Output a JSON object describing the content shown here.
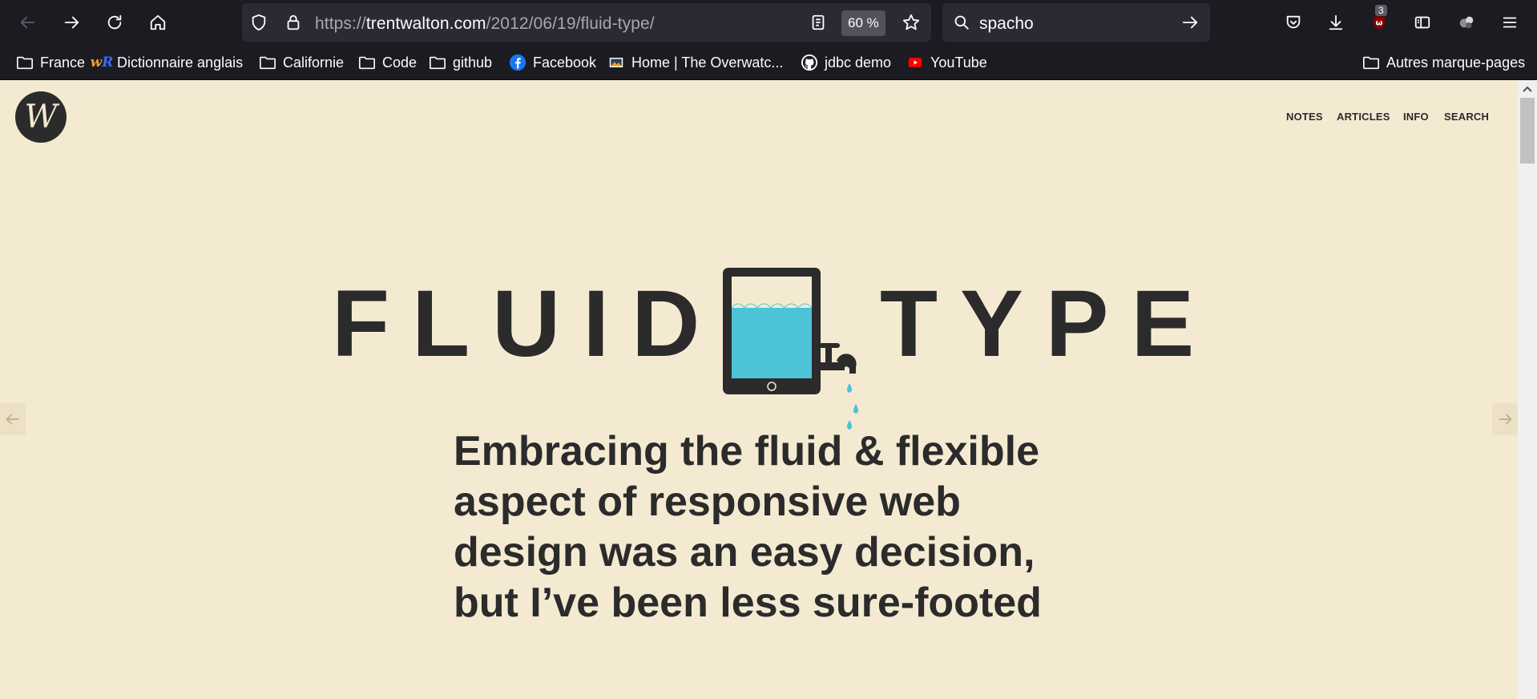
{
  "browser": {
    "url_prefix": "https://",
    "url_domain": "trentwalton.com",
    "url_path": "/2012/06/19/fluid-type/",
    "zoom": "60 %",
    "search_value": "spacho",
    "extension_badge": "3"
  },
  "bookmarks": [
    {
      "label": "France",
      "icon": "folder-icon"
    },
    {
      "label": "Dictionnaire anglais",
      "icon": "wordreference-icon"
    },
    {
      "label": "Californie",
      "icon": "folder-icon"
    },
    {
      "label": "Code",
      "icon": "folder-icon"
    },
    {
      "label": "github",
      "icon": "folder-icon"
    },
    {
      "label": "Facebook",
      "icon": "facebook-icon"
    },
    {
      "label": "Home | The Overwatc...",
      "icon": "overwatch-icon"
    },
    {
      "label": "jdbc demo",
      "icon": "github-icon"
    },
    {
      "label": "YouTube",
      "icon": "youtube-icon"
    }
  ],
  "other_bookmarks": "Autres marque-pages",
  "site": {
    "logo_text": "W",
    "nav": [
      "NOTES",
      "ARTICLES",
      "INFO",
      "SEARCH"
    ],
    "hero_left": "FLUID",
    "hero_right": "TYPE",
    "intro": "Embracing the fluid & flexible aspect of responsive web design was an easy decision, but I’ve been less sure-footed"
  },
  "colors": {
    "page_bg": "#f4ead2",
    "text": "#2b2b2b",
    "water": "#4cc3d6",
    "chrome_bg": "#1c1b22"
  }
}
